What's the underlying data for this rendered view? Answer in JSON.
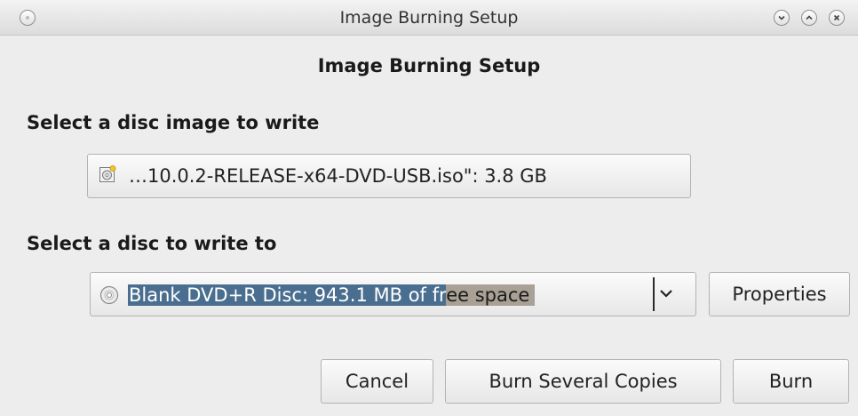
{
  "window": {
    "title": "Image Burning Setup"
  },
  "dialog": {
    "heading": "Image Burning Setup"
  },
  "image_section": {
    "label": "Select a disc image to write",
    "file_button_label": "…10.0.2-RELEASE-x64-DVD-USB.iso\": 3.8 GB",
    "icon": "disc-image-icon"
  },
  "disc_section": {
    "label": "Select a disc to write to",
    "selected_disc_part1": "Blank DVD+R Disc: 943.1 MB of fr",
    "selected_disc_part2": "ee space",
    "icon": "optical-disc-icon",
    "properties_label": "Properties"
  },
  "actions": {
    "cancel_label": "Cancel",
    "burn_several_label": "Burn Several Copies",
    "burn_label": "Burn"
  },
  "colors": {
    "selection_primary": "#4a6e8f",
    "selection_secondary": "#a9a096",
    "background": "#ededed"
  }
}
